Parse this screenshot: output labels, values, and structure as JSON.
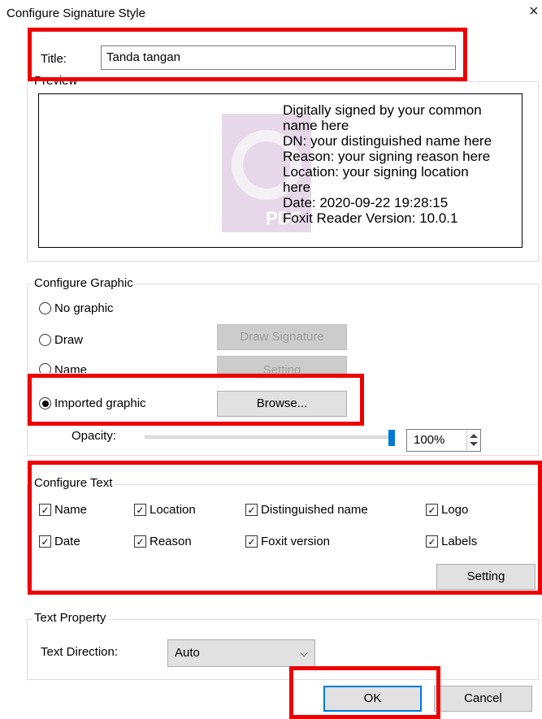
{
  "window": {
    "title": "Configure Signature Style",
    "close_glyph": "×"
  },
  "title_row": {
    "label": "Title:",
    "value": "Tanda tangan"
  },
  "preview": {
    "group_label": "Preview",
    "watermark_text": "PDF",
    "lines": [
      "Digitally signed by your common",
      "name here",
      "DN: your distinguished name here",
      "Reason: your signing reason here",
      "Location: your signing location",
      "here",
      "Date: 2020-09-22 19:28:15",
      "Foxit Reader Version: 10.0.1"
    ]
  },
  "configure_graphic": {
    "group_label": "Configure Graphic",
    "options": [
      {
        "label": "No graphic",
        "selected": false
      },
      {
        "label": "Draw",
        "selected": false
      },
      {
        "label": "Name",
        "selected": false
      },
      {
        "label": "Imported graphic",
        "selected": true
      }
    ],
    "draw_signature_button": "Draw Signature",
    "setting_button": "Setting",
    "browse_button": "Browse...",
    "opacity_label": "Opacity:",
    "opacity_value": "100%",
    "opacity_level": 1.0
  },
  "configure_text": {
    "group_label": "Configure Text",
    "items": [
      {
        "label": "Name",
        "checked": true
      },
      {
        "label": "Location",
        "checked": true
      },
      {
        "label": "Distinguished name",
        "checked": true
      },
      {
        "label": "Logo",
        "checked": true
      },
      {
        "label": "Date",
        "checked": true
      },
      {
        "label": "Reason",
        "checked": true
      },
      {
        "label": "Foxit version",
        "checked": true
      },
      {
        "label": "Labels",
        "checked": true
      }
    ],
    "setting_button": "Setting"
  },
  "text_property": {
    "group_label": "Text Property",
    "direction_label": "Text Direction:",
    "direction_value": "Auto"
  },
  "footer": {
    "ok_button": "OK",
    "cancel_button": "Cancel"
  },
  "colors": {
    "highlight": "#ee0000",
    "accent": "#0078d7"
  }
}
